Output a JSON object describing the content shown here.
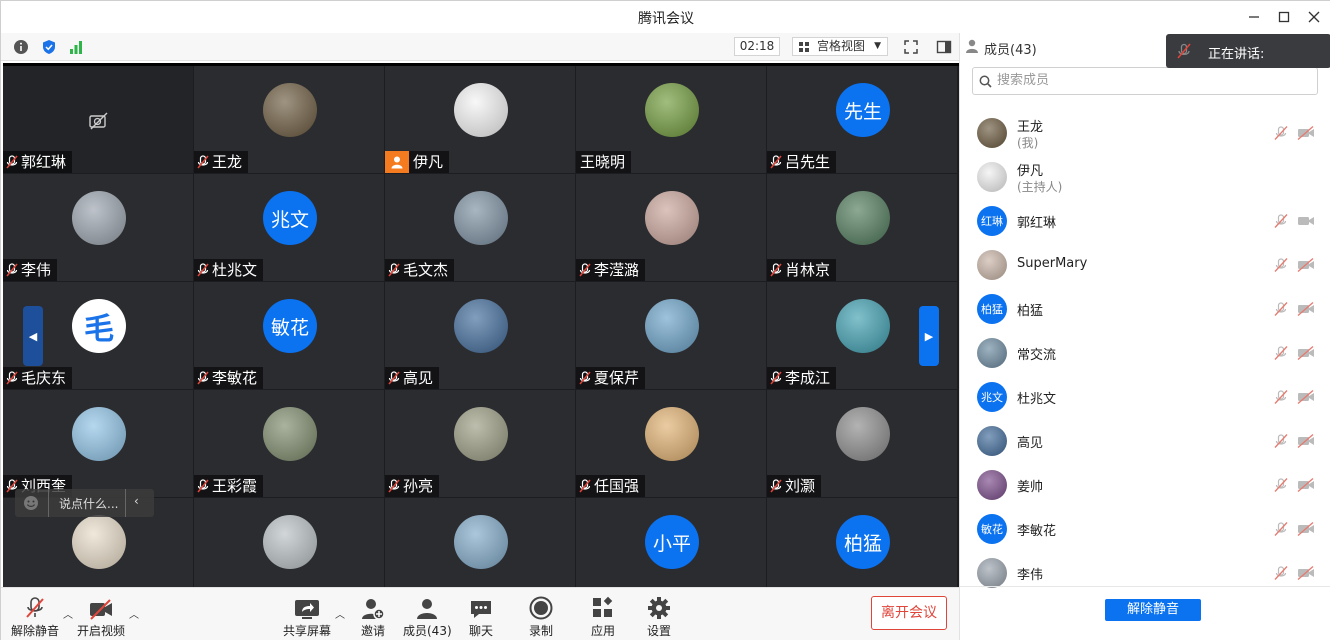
{
  "window": {
    "title": "腾讯会议"
  },
  "toolbar_top": {
    "timer": "02:18",
    "view_label": "宫格视图"
  },
  "tiles": [
    {
      "name": "郭红琳",
      "avatar_text": "",
      "kind": "camoff",
      "muted": true
    },
    {
      "name": "王龙",
      "avatar_text": "",
      "kind": "photo",
      "color": "#6b5a3e",
      "muted": true
    },
    {
      "name": "伊凡",
      "avatar_text": "",
      "kind": "photo",
      "color": "#f4f4f4",
      "host": true,
      "muted": false
    },
    {
      "name": "王晓明",
      "avatar_text": "",
      "kind": "photo",
      "color": "#6f9a3a",
      "muted": false
    },
    {
      "name": "吕先生",
      "avatar_text": "先生",
      "kind": "text",
      "muted": true
    },
    {
      "name": "李伟",
      "avatar_text": "",
      "kind": "photo",
      "color": "#9aa3ad",
      "muted": true
    },
    {
      "name": "杜兆文",
      "avatar_text": "兆文",
      "kind": "text",
      "muted": true
    },
    {
      "name": "毛文杰",
      "avatar_text": "",
      "kind": "photo",
      "color": "#7a8fa0",
      "muted": true
    },
    {
      "name": "李滢潞",
      "avatar_text": "",
      "kind": "photo",
      "color": "#c9a49a",
      "muted": true
    },
    {
      "name": "肖林京",
      "avatar_text": "",
      "kind": "photo",
      "color": "#4f7a5a",
      "muted": true
    },
    {
      "name": "毛庆东",
      "avatar_text": "毛",
      "kind": "logo",
      "muted": true
    },
    {
      "name": "李敏花",
      "avatar_text": "敏花",
      "kind": "text",
      "muted": true
    },
    {
      "name": "高见",
      "avatar_text": "",
      "kind": "photo",
      "color": "#3f6a9a",
      "muted": true
    },
    {
      "name": "夏保芹",
      "avatar_text": "",
      "kind": "photo",
      "color": "#6aa2c8",
      "muted": true
    },
    {
      "name": "李成江",
      "avatar_text": "",
      "kind": "photo",
      "color": "#3d9fb0",
      "muted": true
    },
    {
      "name": "刘西奎",
      "avatar_text": "",
      "kind": "photo",
      "color": "#8ec3e6",
      "muted": true
    },
    {
      "name": "王彩霞",
      "avatar_text": "",
      "kind": "photo",
      "color": "#7c8a6a",
      "muted": true
    },
    {
      "name": "孙亮",
      "avatar_text": "",
      "kind": "photo",
      "color": "#9b9b82",
      "muted": true
    },
    {
      "name": "任国强",
      "avatar_text": "",
      "kind": "photo",
      "color": "#e0b070",
      "muted": true
    },
    {
      "name": "刘灏",
      "avatar_text": "",
      "kind": "photo",
      "color": "#8a8a8a",
      "muted": true
    },
    {
      "name": "",
      "avatar_text": "",
      "kind": "photo",
      "color": "#e8dcc8",
      "muted": true
    },
    {
      "name": "",
      "avatar_text": "",
      "kind": "photo",
      "color": "#b9c0c4",
      "muted": true
    },
    {
      "name": "",
      "avatar_text": "",
      "kind": "photo",
      "color": "#7fa9c8",
      "muted": true
    },
    {
      "name": "",
      "avatar_text": "小平",
      "kind": "text",
      "muted": true
    },
    {
      "name": "",
      "avatar_text": "柏猛",
      "kind": "text",
      "muted": true
    }
  ],
  "chat": {
    "placeholder": "说点什么..."
  },
  "bottom": {
    "unmute": "解除静音",
    "start_video": "开启视频",
    "share": "共享屏幕",
    "invite": "邀请",
    "members": "成员(43)",
    "chat": "聊天",
    "record": "录制",
    "apps": "应用",
    "settings": "设置",
    "leave": "离开会议"
  },
  "panel": {
    "title": "成员(43)",
    "search_placeholder": "搜索成员",
    "unmute_all": "解除静音",
    "members": [
      {
        "name": "王龙",
        "sub": "(我)",
        "kind": "photo",
        "color": "#6b5a3e",
        "avatar_text": "",
        "controls": true
      },
      {
        "name": "伊凡",
        "sub": "(主持人)",
        "kind": "photo",
        "color": "#f0f0f0",
        "avatar_text": "",
        "controls": false
      },
      {
        "name": "郭红琳",
        "sub": "",
        "kind": "text",
        "avatar_text": "红琳",
        "color": "",
        "controls": true,
        "video_off": false
      },
      {
        "name": "SuperMary",
        "sub": "",
        "kind": "photo",
        "color": "#c9b4a6",
        "avatar_text": "",
        "controls": true
      },
      {
        "name": "柏猛",
        "sub": "",
        "kind": "text",
        "avatar_text": "柏猛",
        "color": "",
        "controls": true
      },
      {
        "name": "常交流",
        "sub": "",
        "kind": "photo",
        "color": "#6b8aa0",
        "avatar_text": "",
        "controls": true
      },
      {
        "name": "杜兆文",
        "sub": "",
        "kind": "text",
        "avatar_text": "兆文",
        "color": "",
        "controls": true
      },
      {
        "name": "高见",
        "sub": "",
        "kind": "photo",
        "color": "#3f6a9a",
        "avatar_text": "",
        "controls": true
      },
      {
        "name": "姜帅",
        "sub": "",
        "kind": "photo",
        "color": "#7a4a8a",
        "avatar_text": "",
        "controls": true
      },
      {
        "name": "李敏花",
        "sub": "",
        "kind": "text",
        "avatar_text": "敏花",
        "color": "",
        "controls": true
      },
      {
        "name": "李伟",
        "sub": "",
        "kind": "photo",
        "color": "#9aa3ad",
        "avatar_text": "",
        "controls": true
      }
    ]
  },
  "speaking": {
    "label": "正在讲话:"
  },
  "colors": {
    "accent": "#0b72f0",
    "danger": "#e0453a",
    "host_badge": "#f47b20"
  }
}
